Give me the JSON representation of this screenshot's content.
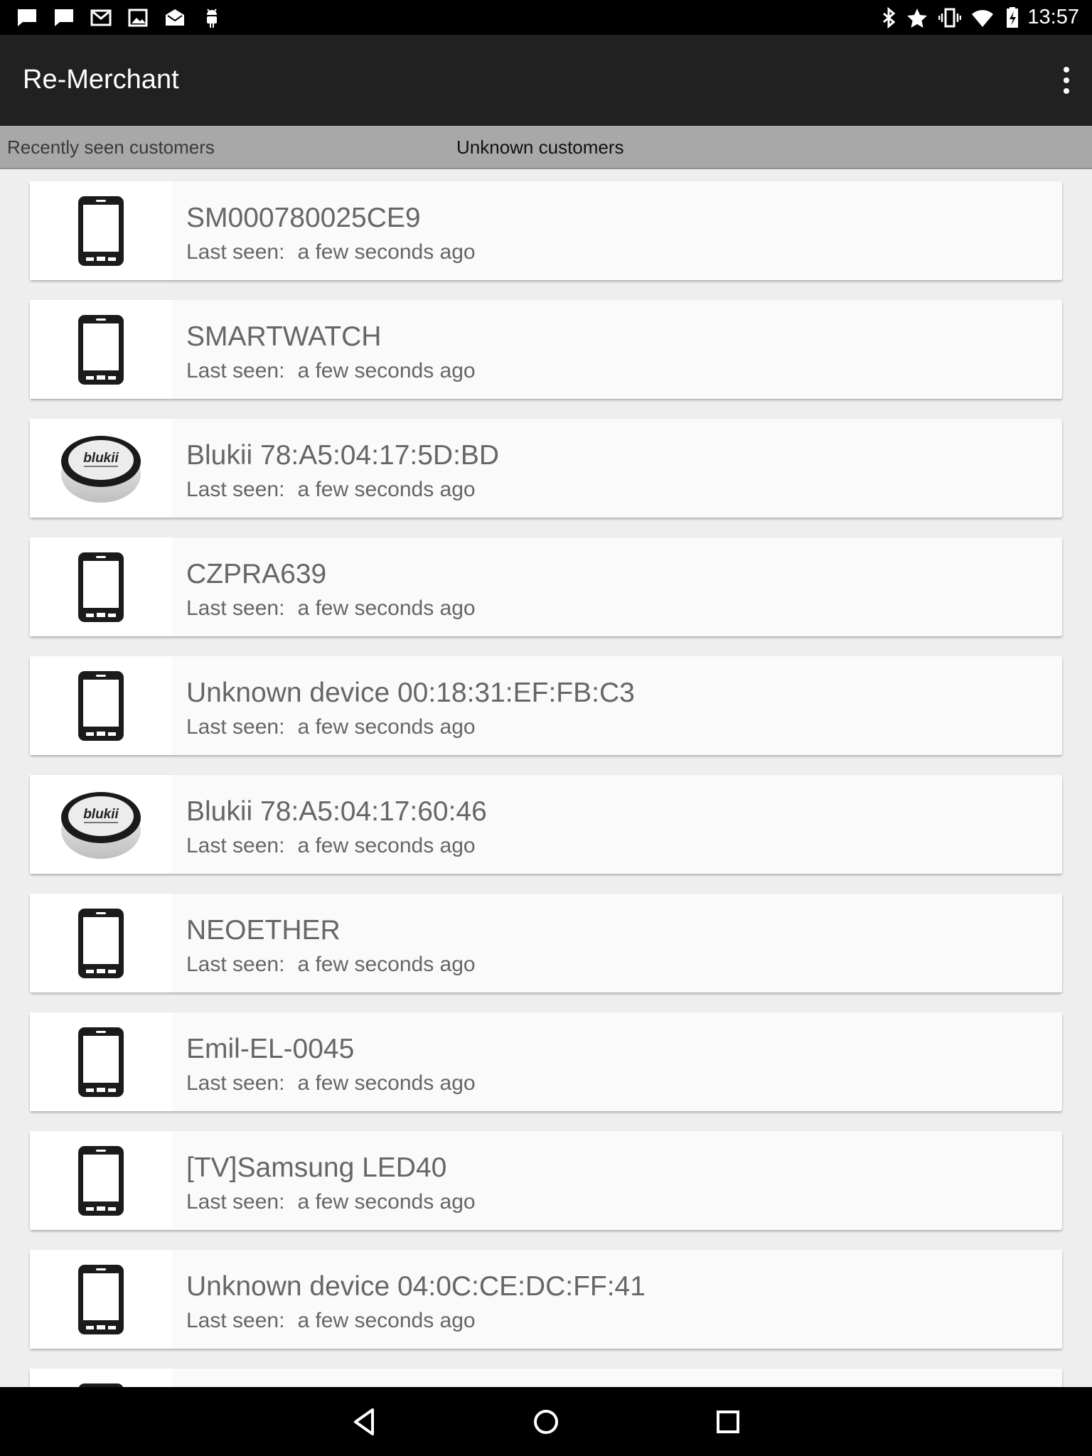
{
  "status_bar": {
    "time": "13:57",
    "left_icons": [
      "chat-notification-icon",
      "chat-notification-icon",
      "gmail-icon",
      "image-icon",
      "mail-icon",
      "android-debug-icon"
    ],
    "right_icons": [
      "bluetooth-icon",
      "star-icon",
      "vibrate-icon",
      "wifi-icon",
      "battery-charging-icon"
    ]
  },
  "action_bar": {
    "title": "Re-Merchant",
    "overflow_icon": "overflow-menu-icon"
  },
  "tabs": [
    "Recently seen customers",
    "Unknown customers"
  ],
  "devices": [
    {
      "name": "SM000780025CE9",
      "label": "Last seen:",
      "value": "a few seconds ago",
      "icon": "phone-icon"
    },
    {
      "name": "SMARTWATCH",
      "label": "Last seen:",
      "value": "a few seconds ago",
      "icon": "phone-icon"
    },
    {
      "name": "Blukii 78:A5:04:17:5D:BD",
      "label": "Last seen:",
      "value": "a few seconds ago",
      "icon": "blukii-beacon-icon",
      "logo_text": "blukii"
    },
    {
      "name": "CZPRA639",
      "label": "Last seen:",
      "value": "a few seconds ago",
      "icon": "phone-icon"
    },
    {
      "name": "Unknown device 00:18:31:EF:FB:C3",
      "label": "Last seen:",
      "value": "a few seconds ago",
      "icon": "phone-icon"
    },
    {
      "name": "Blukii 78:A5:04:17:60:46",
      "label": "Last seen:",
      "value": "a few seconds ago",
      "icon": "blukii-beacon-icon",
      "logo_text": "blukii"
    },
    {
      "name": "NEOETHER",
      "label": "Last seen:",
      "value": "a few seconds ago",
      "icon": "phone-icon"
    },
    {
      "name": "Emil-EL-0045",
      "label": "Last seen:",
      "value": "a few seconds ago",
      "icon": "phone-icon"
    },
    {
      "name": "[TV]Samsung LED40",
      "label": "Last seen:",
      "value": "a few seconds ago",
      "icon": "phone-icon"
    },
    {
      "name": "Unknown device 04:0C:CE:DC:FF:41",
      "label": "Last seen:",
      "value": "a few seconds ago",
      "icon": "phone-icon"
    },
    {
      "name": "",
      "label": "",
      "value": "",
      "icon": "phone-icon"
    }
  ],
  "nav_bar": [
    "back-icon",
    "home-icon",
    "recents-icon"
  ],
  "colors": {
    "action_bar": "#212121",
    "tab_strip": "#a8a8a8",
    "list_bg": "#eeeeee",
    "card_bg": "#fafafa"
  }
}
